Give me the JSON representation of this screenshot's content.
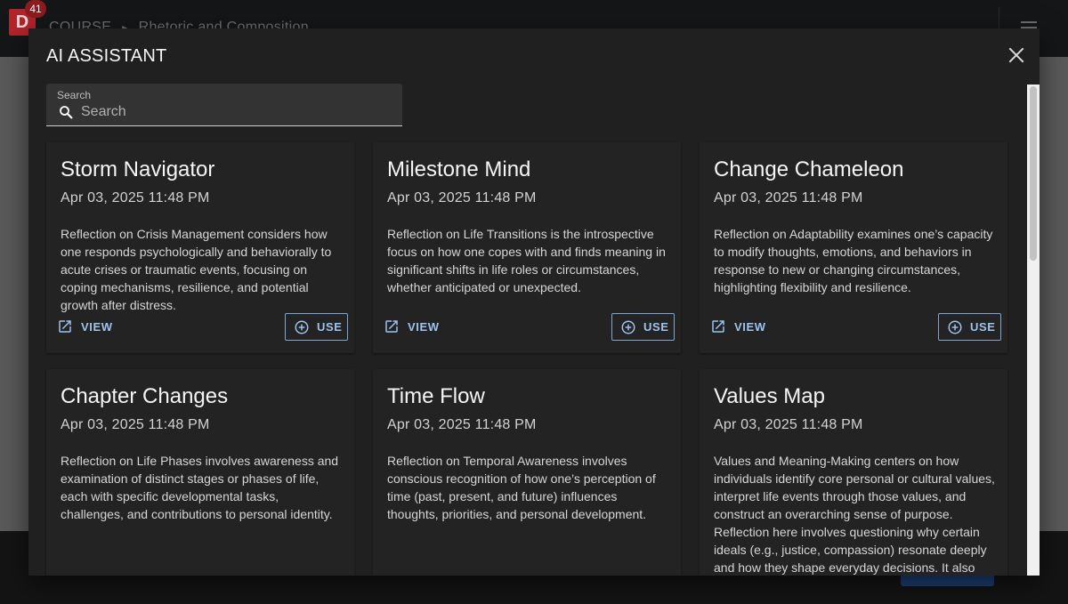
{
  "background": {
    "badge_count": "41",
    "logo_letter": "D",
    "breadcrumb": [
      "COURSE",
      "Rhetoric and Composition"
    ],
    "breadcrumb_separator": "▸"
  },
  "dialog": {
    "title": "AI ASSISTANT",
    "close_icon": "close-icon"
  },
  "search": {
    "label": "Search",
    "placeholder": "Search",
    "value": ""
  },
  "actions": {
    "view_label": "VIEW",
    "use_label": "USE",
    "view_icon": "open-in-new-icon",
    "use_icon": "add-circle-icon"
  },
  "cards": [
    {
      "title": "Storm Navigator",
      "date": "Apr 03, 2025 11:48 PM",
      "description": "Reflection on Crisis Management considers how one responds psychologically and behaviorally to acute crises or traumatic events, focusing on coping mechanisms, resilience, and potential growth after distress."
    },
    {
      "title": "Milestone Mind",
      "date": "Apr 03, 2025 11:48 PM",
      "description": "Reflection on Life Transitions is the introspective focus on how one copes with and finds meaning in significant shifts in life roles or circumstances, whether anticipated or unexpected."
    },
    {
      "title": "Change Chameleon",
      "date": "Apr 03, 2025 11:48 PM",
      "description": "Reflection on Adaptability examines one’s capacity to modify thoughts, emotions, and behaviors in response to new or changing circumstances, highlighting flexibility and resilience."
    },
    {
      "title": "Chapter Changes",
      "date": "Apr 03, 2025 11:48 PM",
      "description": "Reflection on Life Phases involves awareness and examination of distinct stages or phases of life, each with specific developmental tasks, challenges, and contributions to personal identity."
    },
    {
      "title": "Time Flow",
      "date": "Apr 03, 2025 11:48 PM",
      "description": "Reflection on Temporal Awareness involves conscious recognition of how one’s perception of time (past, present, and future) influences thoughts, priorities, and personal development."
    },
    {
      "title": "Values Map",
      "date": "Apr 03, 2025 11:48 PM",
      "description": "Values and Meaning-Making centers on how individuals identify core personal or cultural values, interpret life events through those values, and construct an overarching sense of purpose. Reflection here involves questioning why certain ideals (e.g., justice, compassion) resonate deeply and how they shape everyday decisions. It also"
    }
  ],
  "colors": {
    "dialog_bg": "#202020",
    "card_bg": "#232323",
    "accent": "#9dc3ef",
    "logo_red": "#b3242b"
  }
}
